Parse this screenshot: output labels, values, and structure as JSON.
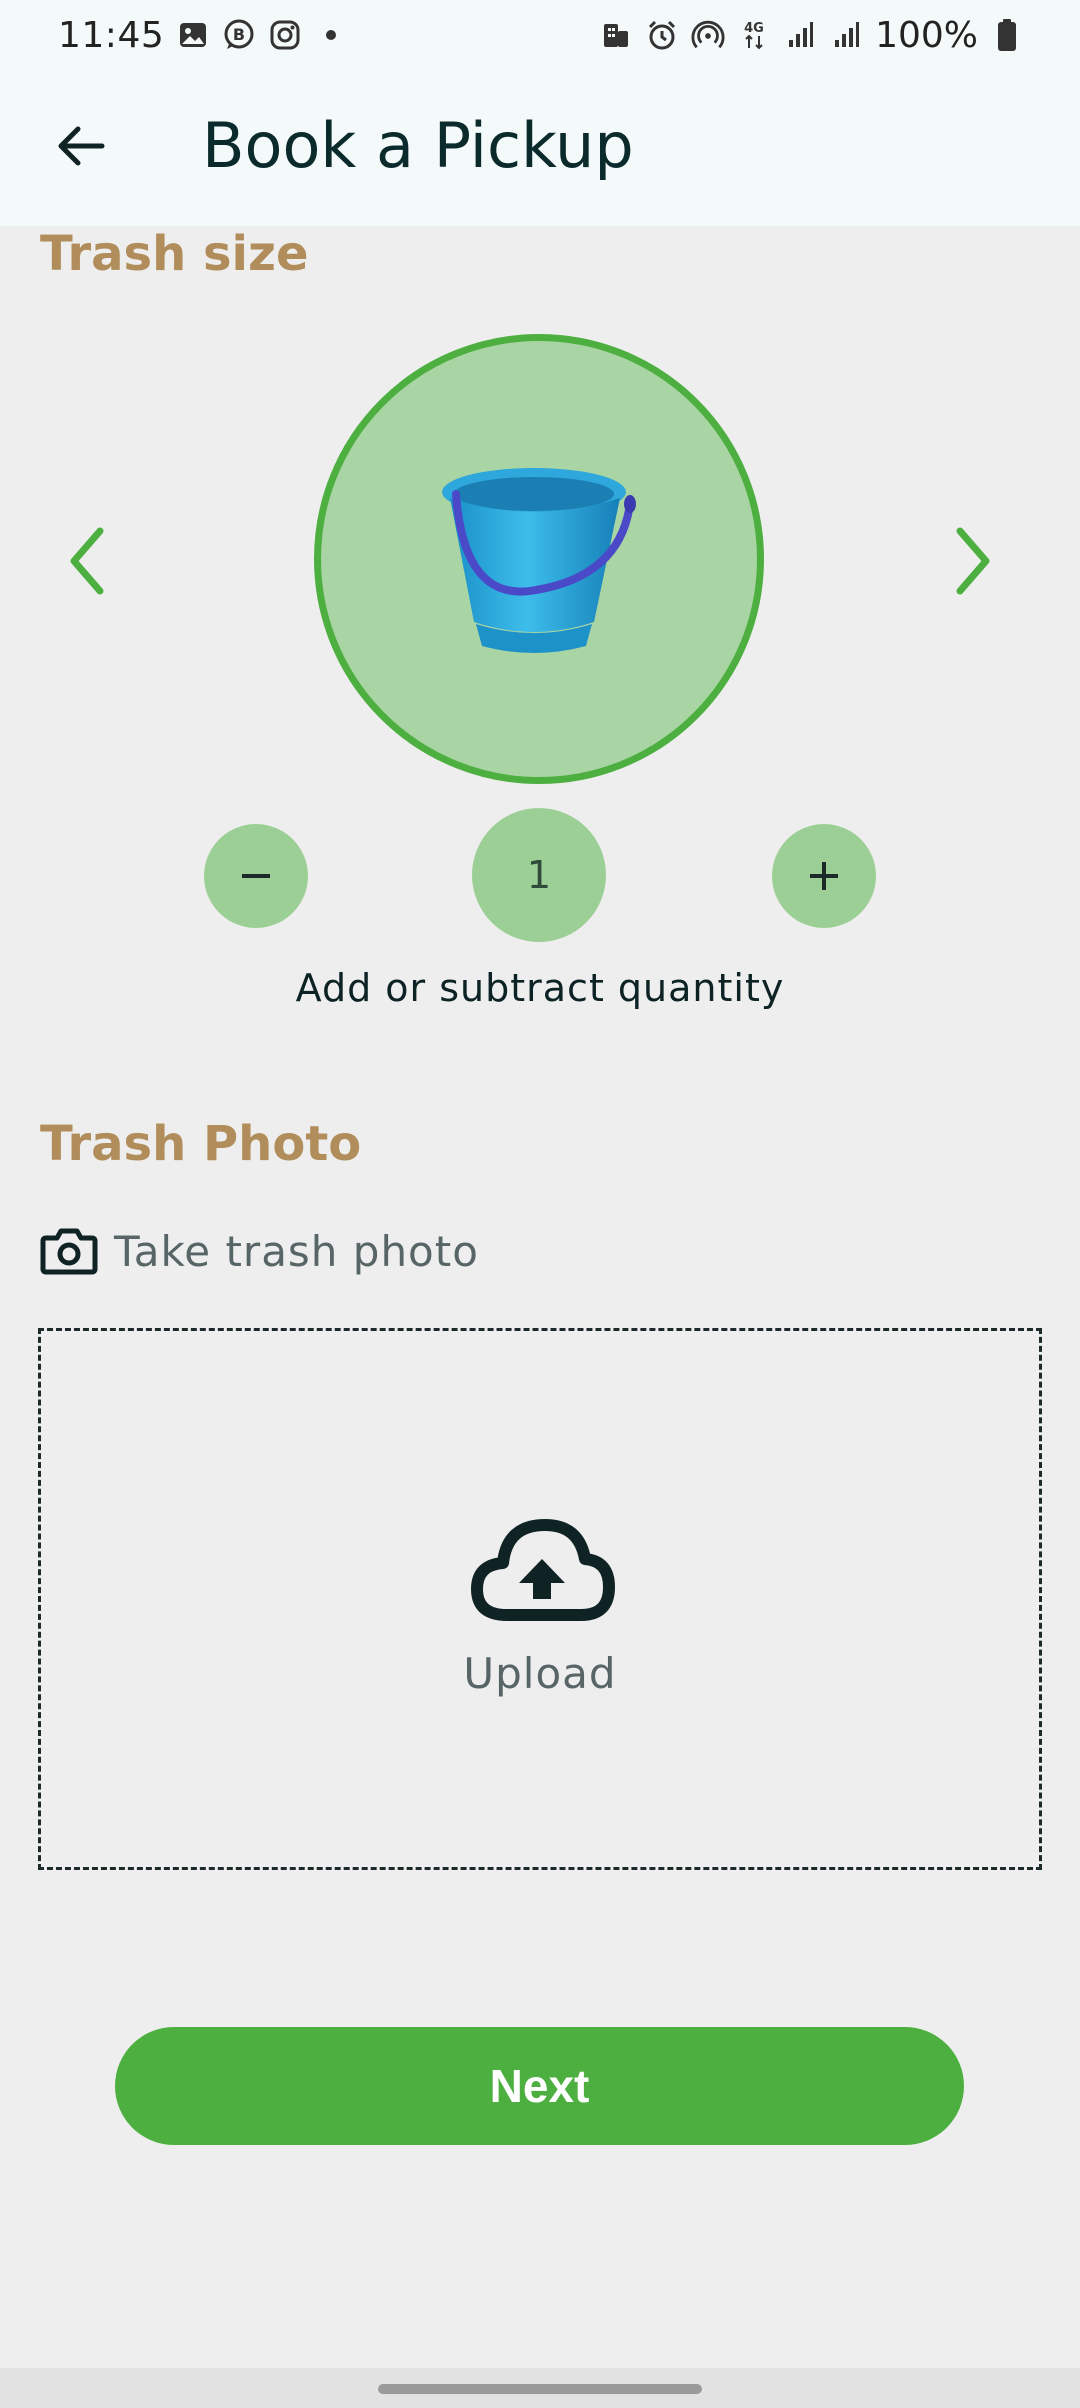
{
  "status_bar": {
    "time": "11:45",
    "battery_text": "100%",
    "left_icons": [
      "gallery-icon",
      "b-messenger-icon",
      "instagram-icon",
      "notification-dot-icon"
    ],
    "right_icons": [
      "building-icon",
      "alarm-icon",
      "hotspot-icon",
      "4g-icon",
      "signal-icon",
      "signal-icon",
      "battery-icon"
    ]
  },
  "app_bar": {
    "title": "Book a Pickup",
    "back_icon": "back-arrow-icon"
  },
  "trash_size": {
    "heading": "Trash size",
    "item_icon": "bucket-icon",
    "prev_icon": "chevron-left-icon",
    "next_icon": "chevron-right-icon"
  },
  "quantity": {
    "value": "1",
    "decrement_label": "−",
    "increment_label": "+",
    "caption": "Add or subtract quantity"
  },
  "trash_photo": {
    "heading": "Trash Photo",
    "take_photo_label": "Take trash photo",
    "upload_label": "Upload"
  },
  "actions": {
    "next_label": "Next"
  },
  "colors": {
    "accent_green": "#4caf3f",
    "light_green": "#a9d5a4",
    "heading_gold": "#b08d5b",
    "background": "#eeeeee",
    "app_bar_bg": "#f4fafa"
  }
}
